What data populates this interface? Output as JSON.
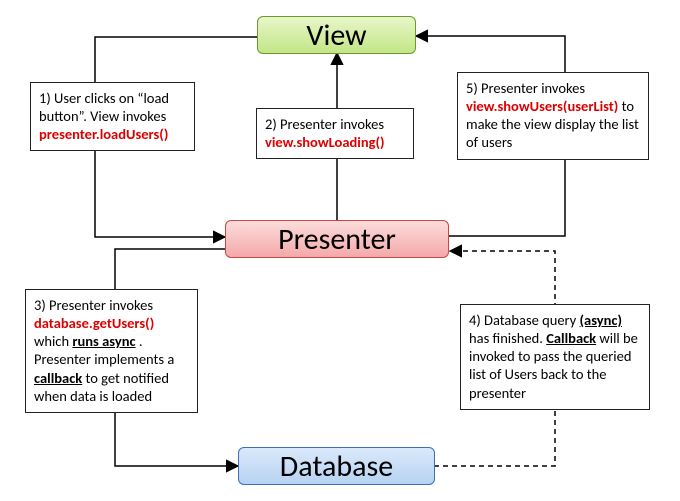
{
  "nodes": {
    "view": "View",
    "presenter": "Presenter",
    "database": "Database"
  },
  "steps": {
    "s1": {
      "prefix": "1) User clicks on “load button”. View invokes ",
      "code": "presenter.loadUsers()"
    },
    "s2": {
      "prefix": "2) Presenter invokes ",
      "code": "view.showLoading()"
    },
    "s3": {
      "prefix": "3) Presenter invokes ",
      "code": "database.getUsers()",
      "mid": " which ",
      "em1": "runs async",
      "rest": ". Presenter implements a ",
      "em2": "callback",
      "tail": " to get notified when data is loaded"
    },
    "s4": {
      "prefix": "4) Database query ",
      "em1": "(async)",
      "mid": " has finished.  ",
      "em2": "Callback",
      "tail": " will be invoked to pass the queried list of Users back to the presenter"
    },
    "s5": {
      "prefix": "5) Presenter invokes ",
      "code": "view.showUsers(userList)",
      "tail": " to make the view display the list of users"
    }
  }
}
